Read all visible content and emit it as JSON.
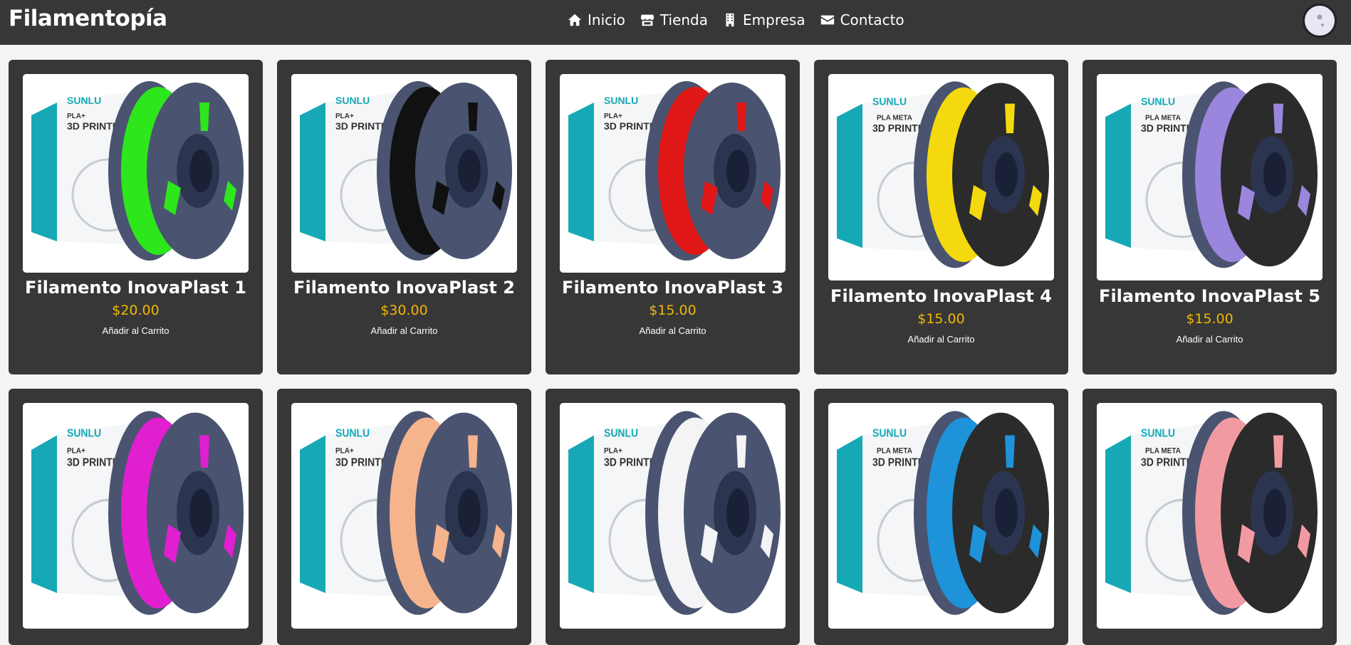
{
  "brand": "Filamentopía",
  "nav": [
    {
      "label": "Inicio",
      "icon": "home-icon"
    },
    {
      "label": "Tienda",
      "icon": "store-icon"
    },
    {
      "label": "Empresa",
      "icon": "building-icon"
    },
    {
      "label": "Contacto",
      "icon": "envelope-icon"
    }
  ],
  "products": [
    {
      "name": "Filamento InovaPlast 1",
      "price": "$20.00",
      "cta": "Añadir al Carrito",
      "color": "#2ee61c",
      "box_brand": "SUNLU",
      "box_line1": "PLA+",
      "box_line2": "3D PRINTIN"
    },
    {
      "name": "Filamento InovaPlast 2",
      "price": "$30.00",
      "cta": "Añadir al Carrito",
      "color": "#111111",
      "box_brand": "SUNLU",
      "box_line1": "PLA+",
      "box_line2": "3D PRINTIN"
    },
    {
      "name": "Filamento InovaPlast 3",
      "price": "$15.00",
      "cta": "Añadir al Carrito",
      "color": "#e01818",
      "box_brand": "SUNLU",
      "box_line1": "PLA+",
      "box_line2": "3D PRINTIN"
    },
    {
      "name": "Filamento InovaPlast 4",
      "price": "$15.00",
      "cta": "Añadir al Carrito",
      "color": "#f5d90f",
      "box_brand": "SUNLU",
      "box_line1": "PLA META",
      "box_line2": "3D PRINTI"
    },
    {
      "name": "Filamento InovaPlast 5",
      "price": "$15.00",
      "cta": "Añadir al Carrito",
      "color": "#9a86dc",
      "box_brand": "SUNLU",
      "box_line1": "PLA META",
      "box_line2": "3D PRINTI"
    },
    {
      "name": "",
      "price": "",
      "cta": "",
      "color": "#e01fd0",
      "box_brand": "SUNLU",
      "box_line1": "PLA+",
      "box_line2": "3D PRINTI"
    },
    {
      "name": "",
      "price": "",
      "cta": "",
      "color": "#f6b48c",
      "box_brand": "SUNLU",
      "box_line1": "PLA+",
      "box_line2": "3D PRINTI"
    },
    {
      "name": "",
      "price": "",
      "cta": "",
      "color": "#f4f4f6",
      "box_brand": "SUNLU",
      "box_line1": "PLA+",
      "box_line2": "3D PRINTI"
    },
    {
      "name": "",
      "price": "",
      "cta": "",
      "color": "#1e93da",
      "box_brand": "SUNLU",
      "box_line1": "PLA META",
      "box_line2": "3D PRINTI"
    },
    {
      "name": "",
      "price": "",
      "cta": "",
      "color": "#f29aa2",
      "box_brand": "SUNLU",
      "box_line1": "PLA META",
      "box_line2": "3D PRINTI"
    }
  ],
  "colors": {
    "navbar": "#373737",
    "card": "#373737",
    "price": "#f2b705",
    "box_accent": "#16a9b5",
    "spool": "#4a5470"
  }
}
